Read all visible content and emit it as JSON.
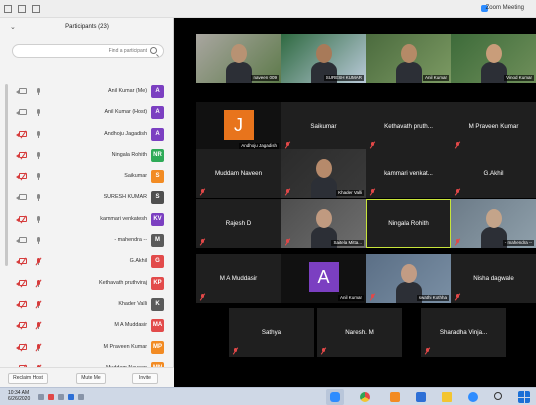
{
  "window": {
    "title": "Zoom Meeting"
  },
  "participants_panel": {
    "title": "Participants (23)",
    "search_placeholder": "Find a participant",
    "participants": [
      {
        "name": "Anil Kumar (Me)",
        "initial": "A",
        "color": "#7b3fc1",
        "muted": false,
        "camera_off": false
      },
      {
        "name": "Anil Kumar (Host)",
        "initial": "A",
        "color": "#7b3fc1",
        "muted": false,
        "camera_off": false
      },
      {
        "name": "Andhoju Jagadish",
        "initial": "A",
        "color": "#7b3fc1",
        "muted": false,
        "camera_off": true
      },
      {
        "name": "Ningala Rohith",
        "initial": "NR",
        "color": "#2eaa57",
        "muted": false,
        "camera_off": true
      },
      {
        "name": "Saikumar",
        "initial": "S",
        "color": "#f28b23",
        "muted": false,
        "camera_off": true
      },
      {
        "name": "SURESH KUMAR",
        "initial": "S",
        "color": "#4f4f4f",
        "muted": false,
        "camera_off": false
      },
      {
        "name": "kammari venkatesh",
        "initial": "KV",
        "color": "#7b3fc1",
        "muted": false,
        "camera_off": true
      },
      {
        "name": "- mahendra --",
        "initial": "M",
        "color": "#5a5a5a",
        "muted": false,
        "camera_off": false
      },
      {
        "name": "G.Akhil",
        "initial": "G",
        "color": "#e24a4a",
        "muted": true,
        "camera_off": true
      },
      {
        "name": "Kethavath pruthviraj",
        "initial": "KP",
        "color": "#e24a4a",
        "muted": true,
        "camera_off": true
      },
      {
        "name": "Khader Valli",
        "initial": "K",
        "color": "#5a5a5a",
        "muted": true,
        "camera_off": true
      },
      {
        "name": "M A Muddasir",
        "initial": "MA",
        "color": "#e24a4a",
        "muted": true,
        "camera_off": true
      },
      {
        "name": "M Praveen Kumar",
        "initial": "MP",
        "color": "#f28b23",
        "muted": true,
        "camera_off": true
      },
      {
        "name": "Muddam Naveen",
        "initial": "MN",
        "color": "#f28b23",
        "muted": true,
        "camera_off": true
      }
    ],
    "footer": {
      "invite": "Invite",
      "mute_me": "Mute Me",
      "reclaim_host": "Reclaim Host"
    }
  },
  "tiles": [
    {
      "name": "Vinod Kumar",
      "video": true,
      "row": 0,
      "col": 0,
      "muted": false
    },
    {
      "name": "Anil Kumar",
      "video": true,
      "row": 0,
      "col": 1,
      "muted": false
    },
    {
      "name": "SURESH KUMAR",
      "video": true,
      "row": 0,
      "col": 2,
      "muted": false
    },
    {
      "name": "naveen 009",
      "video": true,
      "row": 0,
      "col": 3,
      "muted": false
    },
    {
      "name": "M Praveen Kumar",
      "video": false,
      "row": 1,
      "col": 0,
      "muted": true
    },
    {
      "name": "Kethavath pruth...",
      "video": false,
      "row": 1,
      "col": 1,
      "muted": true
    },
    {
      "name": "Saikumar",
      "video": false,
      "row": 1,
      "col": 2,
      "muted": true
    },
    {
      "name": "Andhoju Jagadish",
      "video": true,
      "row": 1,
      "col": 3,
      "muted": false,
      "avatar": "J",
      "avatar_color": "#e8741c"
    },
    {
      "name": "G.Akhil",
      "video": false,
      "row": 2,
      "col": 0,
      "muted": true
    },
    {
      "name": "kammari  venkat...",
      "video": false,
      "row": 2,
      "col": 1,
      "muted": true
    },
    {
      "name": "Khader Valli",
      "video": true,
      "row": 2,
      "col": 2,
      "muted": true
    },
    {
      "name": "Muddam Naveen",
      "video": false,
      "row": 2,
      "col": 3,
      "muted": true
    },
    {
      "name": "- mahendra --",
      "video": true,
      "row": 3,
      "col": 0,
      "muted": true
    },
    {
      "name": "Ningala Rohith",
      "video": false,
      "row": 3,
      "col": 1,
      "muted": false,
      "active": true
    },
    {
      "name": "Saitela Mitta...",
      "video": true,
      "row": 3,
      "col": 2,
      "muted": true
    },
    {
      "name": "Rajesh D",
      "video": false,
      "row": 3,
      "col": 3,
      "muted": true
    },
    {
      "name": "Nisha dagwale",
      "video": false,
      "row": 4,
      "col": 0,
      "muted": true
    },
    {
      "name": "swathi Kothha",
      "video": true,
      "row": 4,
      "col": 1,
      "muted": true
    },
    {
      "name": "Anil Kumar",
      "video": true,
      "row": 4,
      "col": 2,
      "muted": false,
      "avatar": "A",
      "avatar_color": "#7b3fc1"
    },
    {
      "name": "M A Muddasir",
      "video": false,
      "row": 4,
      "col": 3,
      "muted": true
    },
    {
      "name": "Sharadha  Vinja...",
      "video": false,
      "row": 5,
      "col": 0,
      "muted": true
    },
    {
      "name": "Naresh. M",
      "video": false,
      "row": 5,
      "col": 1,
      "muted": true
    },
    {
      "name": "Sathya",
      "video": false,
      "row": 5,
      "col": 2,
      "muted": true
    }
  ],
  "taskbar": {
    "time": "10:34 AM",
    "date": "6/26/2020"
  }
}
